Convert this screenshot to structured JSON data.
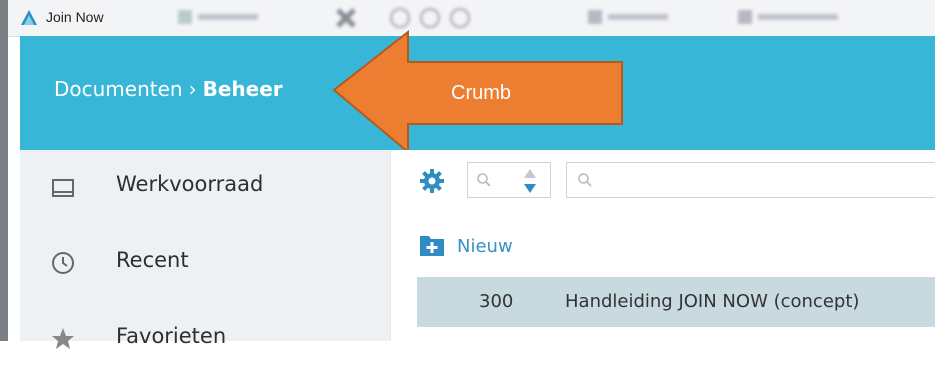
{
  "window": {
    "title": "Join Now"
  },
  "breadcrumb": {
    "parent": "Documenten",
    "separator": "›",
    "current": "Beheer"
  },
  "callout": {
    "label": "Crumb",
    "color": "#ec7d31"
  },
  "sidebar": {
    "items": [
      {
        "label": "Werkvoorraad",
        "icon": "inbox-icon"
      },
      {
        "label": "Recent",
        "icon": "clock-icon"
      },
      {
        "label": "Favorieten",
        "icon": "star-icon"
      }
    ]
  },
  "toolbar": {
    "new_label": "Nieuw"
  },
  "documents": [
    {
      "number": "300",
      "title": "Handleiding JOIN NOW (concept)"
    }
  ],
  "colors": {
    "header": "#37b6d8",
    "accent": "#2f8dc4",
    "selected_row": "#c8d9e0"
  }
}
